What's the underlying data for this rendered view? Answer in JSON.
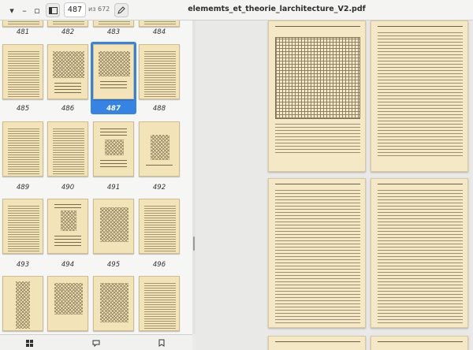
{
  "header": {
    "page_number": "487",
    "page_total": "из 672",
    "doc_title": "elememts_et_theorie_larchitecture_V2.pdf"
  },
  "sidebar": {
    "rows": [
      [
        "481",
        "482",
        "483",
        "484"
      ],
      [
        "485",
        "486",
        "487",
        "488"
      ],
      [
        "489",
        "490",
        "491",
        "492"
      ],
      [
        "493",
        "494",
        "495",
        "496"
      ]
    ],
    "selected_page": "487"
  },
  "switcher": {
    "icons": [
      "thumbnails-icon",
      "annotations-icon",
      "bookmarks-icon"
    ]
  }
}
